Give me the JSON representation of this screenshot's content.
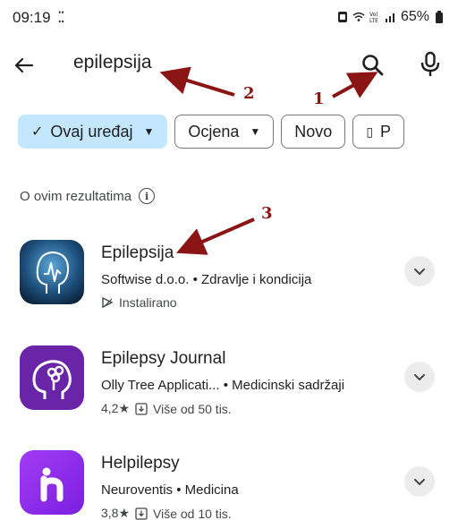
{
  "status_bar": {
    "time": "09:19",
    "battery": "65%"
  },
  "search": {
    "query": "epilepsija"
  },
  "annotations": [
    "1",
    "2",
    "3"
  ],
  "chips": [
    {
      "label": "Ovaj uređaj",
      "selected": true
    },
    {
      "label": "Ocjena",
      "dropdown": true
    },
    {
      "label": "Novo"
    },
    {
      "label": "P"
    }
  ],
  "results_info": {
    "label": "O ovim rezultatima"
  },
  "apps": [
    {
      "title": "Epilepsija",
      "developer": "Softwise d.o.o.",
      "category": "Zdravlje i kondicija",
      "meta": "Instalirano"
    },
    {
      "title": "Epilepsy Journal",
      "developer": "Olly Tree Applicati...",
      "category": "Medicinski sadržaji",
      "rating": "4,2★",
      "downloads": "Više od 50 tis."
    },
    {
      "title": "Helpilepsy",
      "developer": "Neuroventis",
      "category": "Medicina",
      "rating": "3,8★",
      "downloads": "Više od 10 tis."
    }
  ],
  "colors": {
    "selected_chip": "#c2e7ff",
    "annotation": "#8b1414",
    "journal_icon": "#6a24a8",
    "helpilepsy_icon": "#8f2cf0"
  }
}
